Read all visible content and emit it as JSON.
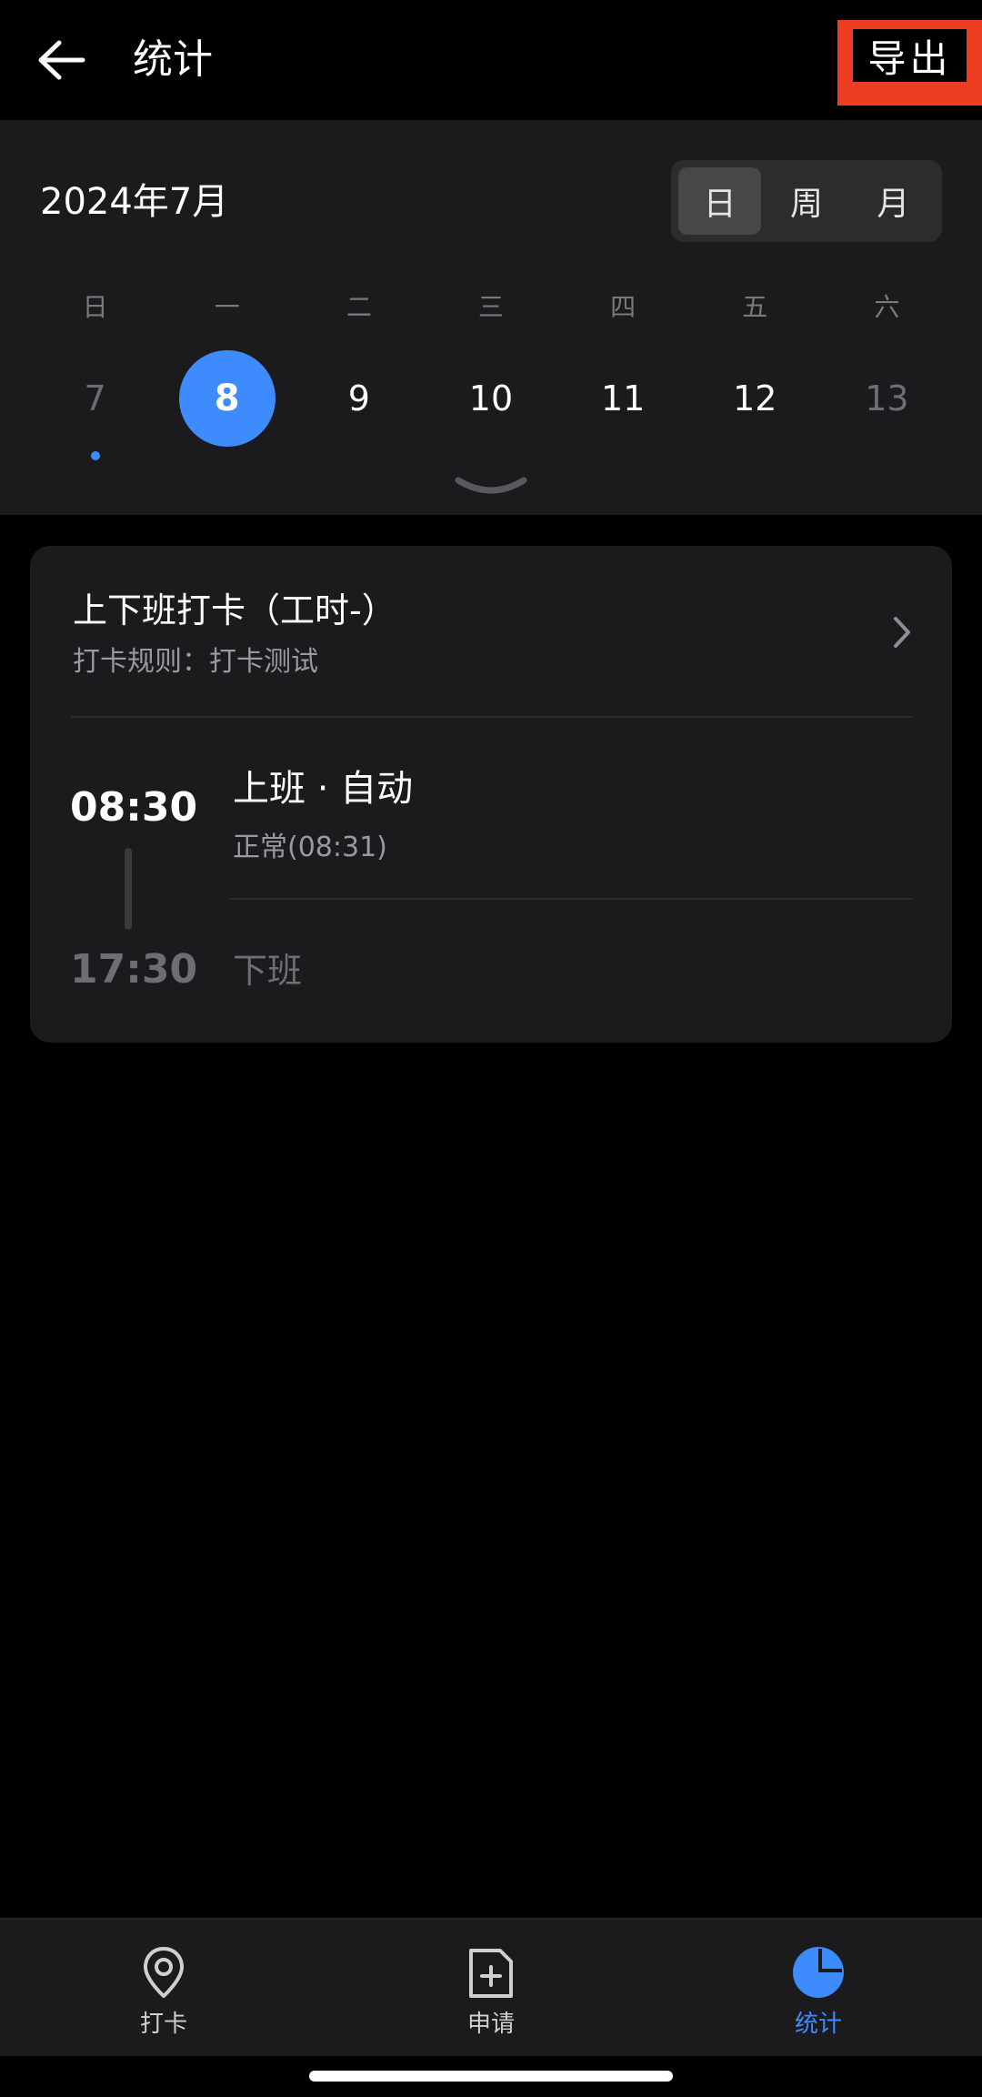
{
  "header": {
    "title": "统计",
    "export_label": "导出"
  },
  "calendar": {
    "month_label": "2024年7月",
    "view_modes": [
      "日",
      "周",
      "月"
    ],
    "active_view": "日",
    "weekdays": [
      "日",
      "一",
      "二",
      "三",
      "四",
      "五",
      "六"
    ],
    "dates": [
      "7",
      "8",
      "9",
      "10",
      "11",
      "12",
      "13"
    ],
    "selected_date": "8",
    "dates_with_records": [
      "7"
    ]
  },
  "card": {
    "title": "上下班打卡（工时-）",
    "rule": "打卡规则：打卡测试",
    "clock_in_time": "08:30",
    "clock_out_time": "17:30",
    "clock_in_label": "上班 · 自动",
    "clock_in_status": "正常(08:31)",
    "clock_out_label": "下班"
  },
  "bottom_nav": {
    "items": [
      {
        "label": "打卡",
        "icon": "location-pin-icon"
      },
      {
        "label": "申请",
        "icon": "add-document-icon"
      },
      {
        "label": "统计",
        "icon": "pie-chart-icon"
      }
    ],
    "active": "统计"
  },
  "colors": {
    "accent": "#3d8bfd",
    "export_highlight": "#ee3d22",
    "panel": "#1b1b1d",
    "background": "#000000"
  }
}
